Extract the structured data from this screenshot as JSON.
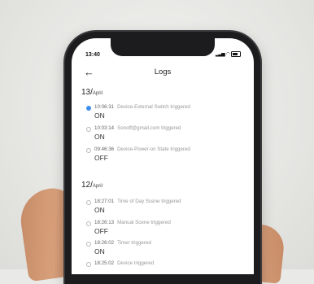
{
  "status_bar": {
    "time": "13:40"
  },
  "header": {
    "title": "Logs"
  },
  "groups": [
    {
      "day": "13/",
      "month": "April",
      "entries": [
        {
          "time": "10:06:31",
          "event": "Device-External Switch triggered",
          "state": "ON",
          "highlight": true
        },
        {
          "time": "10:03:14",
          "event": "Sonoff@gmail.com triggered",
          "state": "ON",
          "highlight": false
        },
        {
          "time": "09:46:36",
          "event": "Device-Power-on State triggered",
          "state": "OFF",
          "highlight": false
        }
      ]
    },
    {
      "day": "12/",
      "month": "April",
      "entries": [
        {
          "time": "18:27:01",
          "event": "Time of Day Scene triggered",
          "state": "ON",
          "highlight": false
        },
        {
          "time": "18:26:13",
          "event": "Manual Scene triggered",
          "state": "OFF",
          "highlight": false
        },
        {
          "time": "18:26:02",
          "event": "Timer triggered",
          "state": "ON",
          "highlight": false
        },
        {
          "time": "18:25:02",
          "event": "Device triggered",
          "state": "",
          "highlight": false
        }
      ]
    }
  ],
  "colors": {
    "accent": "#3c8ee8",
    "dot_inactive": "#b8b8b8"
  }
}
